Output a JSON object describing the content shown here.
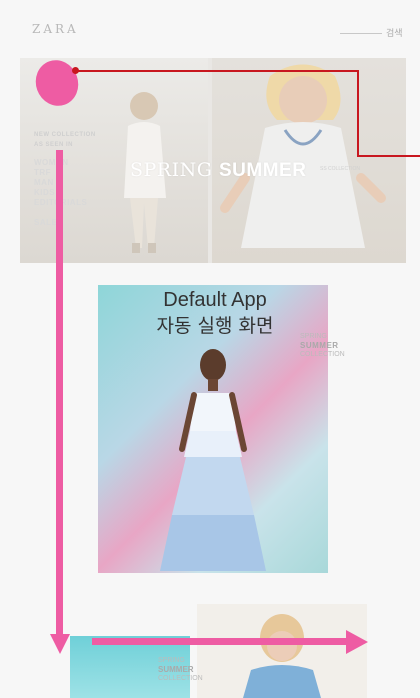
{
  "header": {
    "logo": "ZARA",
    "search_label": "검색"
  },
  "hero": {
    "menu": {
      "top_lines": [
        "NEW COLLECTION",
        "AS SEEN IN"
      ],
      "items": [
        "WOMAN",
        "TRF",
        "MAN",
        "KIDS",
        "EDITORIALS"
      ],
      "sale": "SALE"
    },
    "title_light": "SPRING ",
    "title_bold": "SUMMER",
    "small_text": "SS COLLECTION"
  },
  "annotation": {
    "line1": "Default App",
    "line2": "자동 실행 화면"
  },
  "tile1": {
    "caption_small": "SPRING",
    "caption_big": "SUMMER",
    "caption_sub": "COLLECTION"
  },
  "bottom": {
    "caption_small": "SPRING",
    "caption_big": "SUMMER",
    "caption_sub": "COLLECTION"
  },
  "colors": {
    "annotation_pink": "#ee5ca3",
    "annotation_red": "#c8171f"
  }
}
